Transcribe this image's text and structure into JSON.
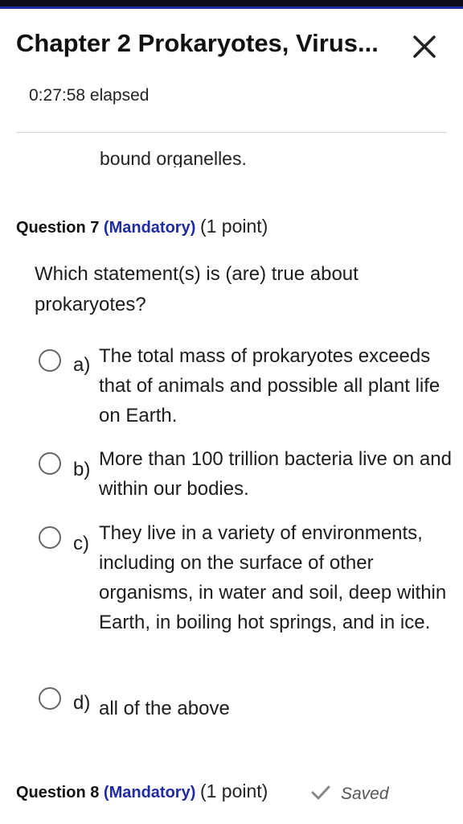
{
  "header": {
    "title": "Chapter 2 Prokaryotes, Virus...",
    "elapsed": "0:27:58 elapsed",
    "close_icon": "close-icon"
  },
  "previous_text": "bound organelles.",
  "question7": {
    "label": "Question 7",
    "mandatory": "(Mandatory)",
    "points": "(1 point)",
    "prompt": "Which statement(s) is (are) true about prokaryotes?",
    "options": [
      {
        "letter": "a)",
        "text": "The total mass of prokaryotes exceeds that of animals and possible all plant life on Earth.",
        "selected": false
      },
      {
        "letter": "b)",
        "text": "More than 100 trillion bacteria live on and within our bodies.",
        "selected": false
      },
      {
        "letter": "c)",
        "text": "They live in a variety of environments, including on the surface of other organisms, in water and soil, deep within Earth, in boiling hot springs, and in ice.",
        "selected": false
      },
      {
        "letter": "d)",
        "text": "all of the above",
        "selected": false
      }
    ]
  },
  "question8": {
    "label": "Question 8",
    "mandatory": "(Mandatory)",
    "points": "(1 point)",
    "status": "Saved",
    "status_icon": "check-icon"
  },
  "colors": {
    "accent": "#1f2ba3",
    "top_bar": "#0d0d1a"
  }
}
